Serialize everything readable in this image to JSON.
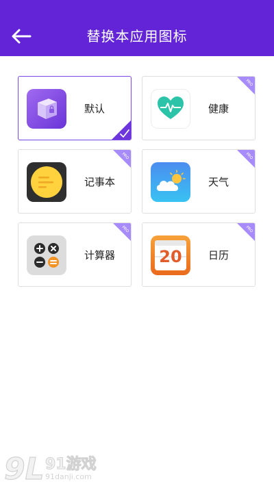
{
  "header": {
    "title": "替换本应用图标",
    "back_icon": "arrow-left-icon"
  },
  "colors": {
    "primary": "#6224d6",
    "selected_border": "#7b46e6",
    "pro_badge": "#a78bfa"
  },
  "badge": {
    "pro": "PRO"
  },
  "icons": [
    {
      "label": "默认",
      "icon": "cube-lock-icon",
      "selected": true,
      "pro": false
    },
    {
      "label": "健康",
      "icon": "heart-pulse-icon",
      "selected": false,
      "pro": true
    },
    {
      "label": "记事本",
      "icon": "notepad-icon",
      "selected": false,
      "pro": true
    },
    {
      "label": "天气",
      "icon": "weather-cloud-sun-icon",
      "selected": false,
      "pro": true
    },
    {
      "label": "计算器",
      "icon": "calculator-icon",
      "selected": false,
      "pro": true
    },
    {
      "label": "日历",
      "icon": "calendar-icon",
      "selected": false,
      "pro": true,
      "icon_text": "20"
    }
  ],
  "watermark": {
    "brand": "91游戏",
    "url": "91danji.com",
    "logo_text": "9L"
  }
}
